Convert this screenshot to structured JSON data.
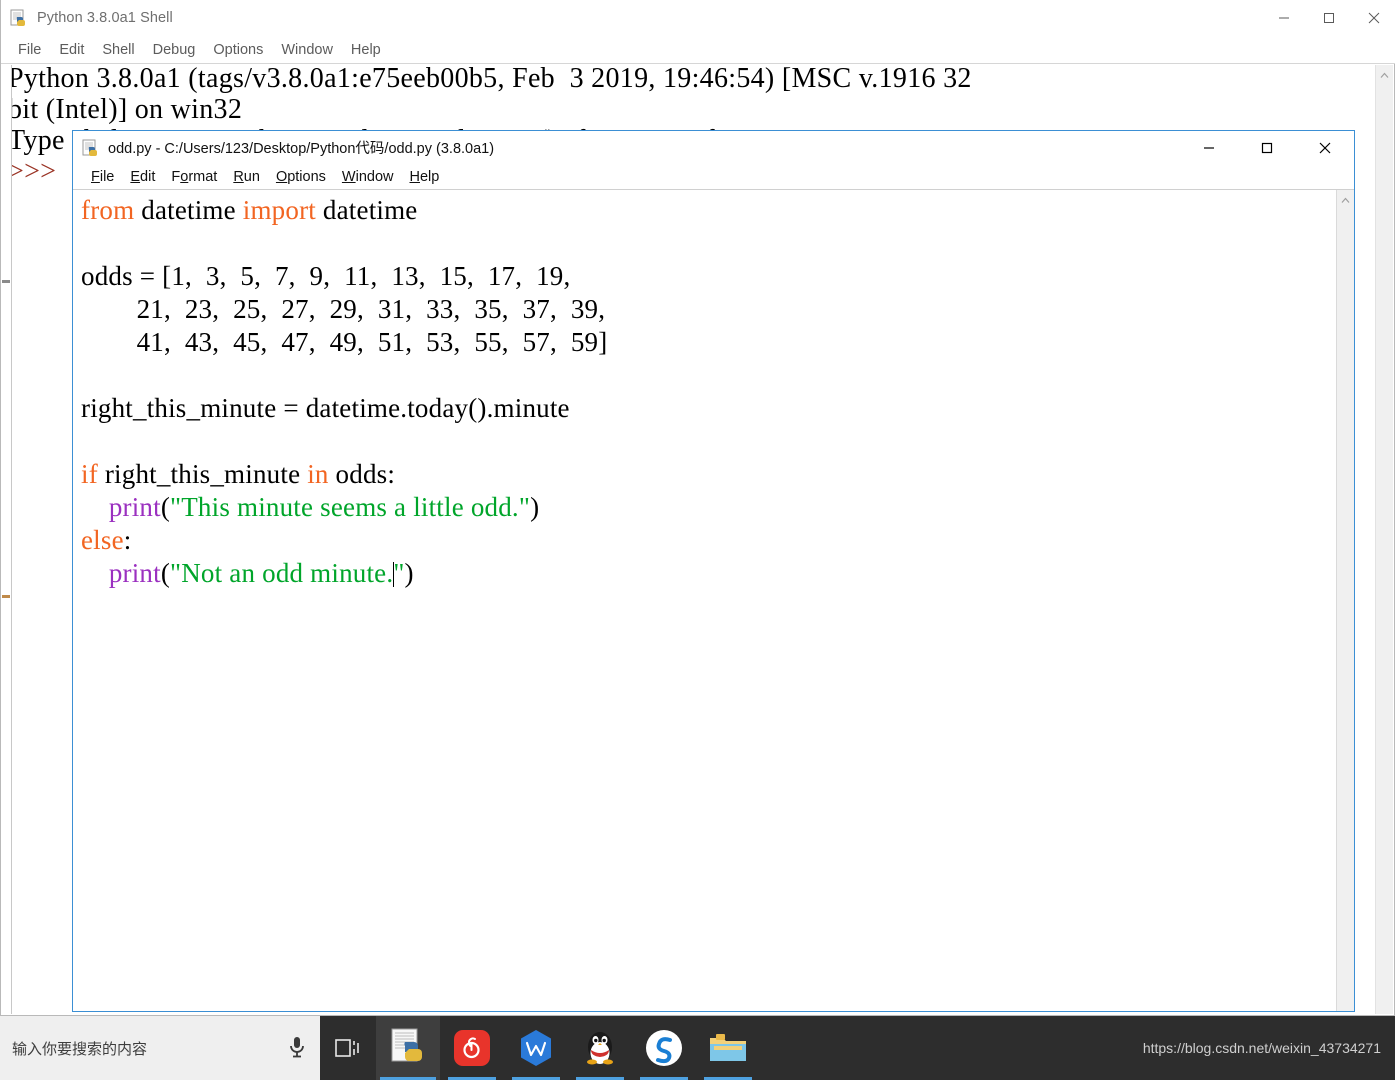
{
  "shell_window": {
    "title": "Python 3.8.0a1 Shell",
    "icon": "python-idle-icon",
    "menu": [
      "File",
      "Edit",
      "Shell",
      "Debug",
      "Options",
      "Window",
      "Help"
    ],
    "controls": {
      "minimize": "minimize-button",
      "maximize": "maximize-button",
      "close": "close-button"
    },
    "output_lines": [
      "Python 3.8.0a1 (tags/v3.8.0a1:e75eeb00b5, Feb  3 2019, 19:46:54) [MSC v.1916 32",
      "bit (Intel)] on win32",
      "Type \"help\", \"copyright\", \"credits\" or \"license()\" for more information."
    ],
    "prompt": ">>>"
  },
  "editor_window": {
    "title": "odd.py - C:/Users/123/Desktop/Python代码/odd.py (3.8.0a1)",
    "icon": "python-idle-icon",
    "menu": [
      {
        "mnemonic": "F",
        "rest": "ile"
      },
      {
        "mnemonic": "E",
        "rest": "dit"
      },
      {
        "pre": "F",
        "mnemonic": "o",
        "rest": "rmat"
      },
      {
        "mnemonic": "R",
        "rest": "un"
      },
      {
        "mnemonic": "O",
        "rest": "ptions"
      },
      {
        "mnemonic": "W",
        "rest": "indow"
      },
      {
        "mnemonic": "H",
        "rest": "elp"
      }
    ],
    "controls": {
      "minimize": "minimize-button",
      "maximize": "maximize-button",
      "close": "close-button"
    },
    "code": {
      "line1_kw": "from",
      "line1_mid": " datetime ",
      "line1_kw2": "import",
      "line1_end": " datetime",
      "line3": "odds = [1,  3,  5,  7,  9,  11,  13,  15,  17,  19,",
      "line4": "        21,  23,  25,  27,  29,  31,  33,  35,  37,  39,",
      "line5": "        41,  43,  45,  47,  49,  51,  53,  55,  57,  59]",
      "line7": "right_this_minute = datetime.today().minute",
      "line9_kw": "if",
      "line9_mid": " right_this_minute ",
      "line9_kw2": "in",
      "line9_end": " odds:",
      "line10_indent": "    ",
      "line10_fn": "print",
      "line10_open": "(",
      "line10_str": "\"This minute seems a little odd.\"",
      "line10_close": ")",
      "line11_kw": "else",
      "line11_end": ":",
      "line12_indent": "    ",
      "line12_fn": "print",
      "line12_open": "(",
      "line12_str_a": "\"Not an odd minute.",
      "line12_str_b": "\"",
      "line12_close": ")"
    }
  },
  "taskbar": {
    "search_placeholder": "输入你要搜索的内容",
    "mic_icon": "microphone-icon",
    "taskview_icon": "task-view-icon",
    "apps": [
      {
        "name": "python-idle-taskbar-icon",
        "label": "Python IDLE",
        "active": true
      },
      {
        "name": "netease-music-taskbar-icon",
        "label": "NetEase Cloud Music",
        "active": false
      },
      {
        "name": "wps-office-taskbar-icon",
        "label": "WPS Office",
        "active": false
      },
      {
        "name": "qq-taskbar-icon",
        "label": "QQ",
        "active": false
      },
      {
        "name": "sogou-taskbar-icon",
        "label": "Sogou",
        "active": false
      },
      {
        "name": "file-explorer-taskbar-icon",
        "label": "File Explorer",
        "active": false
      }
    ],
    "watermark": "https://blog.csdn.net/weixin_43734271"
  },
  "colors": {
    "keyword": "#f26522",
    "builtin": "#9b30c0",
    "string": "#00a52a",
    "prompt": "#9a3324",
    "editor_border": "#3b8fd4",
    "taskbar_bg": "#2d2d2d",
    "taskbar_accent": "#4ea1e0"
  }
}
